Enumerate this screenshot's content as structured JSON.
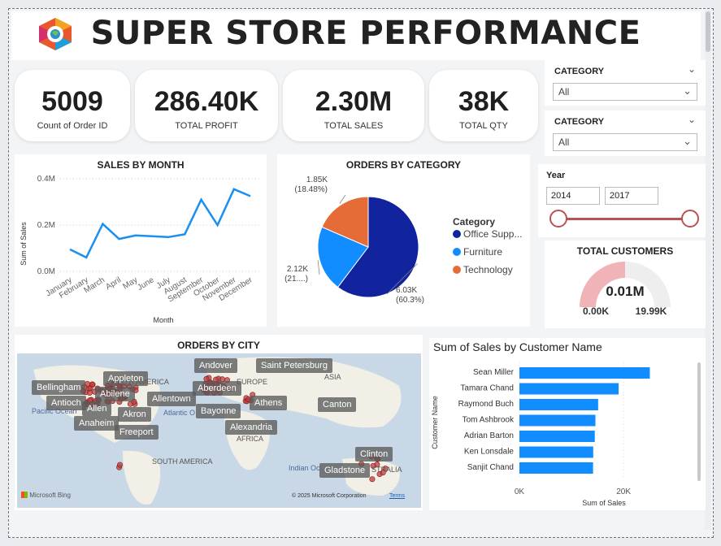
{
  "header": {
    "title": "SUPER STORE PERFORMANCE"
  },
  "kpis": [
    {
      "value": "5009",
      "label": "Count of Order ID"
    },
    {
      "value": "286.40K",
      "label": "TOTAL PROFIT"
    },
    {
      "value": "2.30M",
      "label": "TOTAL SALES"
    },
    {
      "value": "38K",
      "label": "TOTAL QTY"
    }
  ],
  "slicers": [
    {
      "header": "CATEGORY",
      "value": "All"
    },
    {
      "header": "CATEGORY",
      "value": "All"
    }
  ],
  "year_slicer": {
    "header": "Year",
    "from": "2014",
    "to": "2017",
    "range_fraction": [
      0,
      1
    ]
  },
  "total_customers": {
    "title": "TOTAL CUSTOMERS",
    "value": "0.01M",
    "min": "0.00K",
    "max": "19.99K",
    "fill_fraction": 0.5,
    "color": "#f0b4b8"
  },
  "map": {
    "title": "ORDERS BY CITY",
    "cities": [
      "Andover",
      "Saint Petersburg",
      "Appleton",
      "Bellingham",
      "Abilene",
      "Aberdeen",
      "Allentown",
      "Antioch",
      "Allen",
      "Akron",
      "Athens",
      "Canton",
      "Bayonne",
      "Anaheim",
      "Freeport",
      "Alexandria",
      "Clinton",
      "Gladstone"
    ],
    "regions": [
      "EUROPE",
      "ASIA",
      "AFRICA",
      "SOUTH AMERICA",
      "Pacific Ocean",
      "Atlantic O",
      "Indian Oc",
      "STRALIA"
    ],
    "attribution": "© 2025 Microsoft Corporation",
    "terms": "Terms",
    "brand": "Microsoft Bing",
    "point_color": "#c43b3b"
  },
  "chart_data": [
    {
      "type": "line",
      "title": "SALES BY MONTH",
      "xlabel": "Month",
      "ylabel": "Sum of Sales",
      "categories": [
        "January",
        "February",
        "March",
        "April",
        "May",
        "June",
        "July",
        "August",
        "September",
        "October",
        "November",
        "December"
      ],
      "values": [
        0.095,
        0.06,
        0.205,
        0.14,
        0.155,
        0.152,
        0.148,
        0.16,
        0.31,
        0.2,
        0.355,
        0.325
      ],
      "yticks": [
        "0.0M",
        "0.2M",
        "0.4M"
      ],
      "ylim": [
        0,
        0.4
      ],
      "grid": true,
      "color": "#1a8ff0"
    },
    {
      "type": "pie",
      "title": "ORDERS BY CATEGORY",
      "legend_title": "Category",
      "legend_position": "right",
      "slices": [
        {
          "name": "Office Supp...",
          "value": 6.03,
          "label": "6.03K",
          "pct": "(60.3%)",
          "color": "#12239e"
        },
        {
          "name": "Furniture",
          "value": 2.12,
          "label": "2.12K",
          "pct": "(21....)",
          "color": "#118dff"
        },
        {
          "name": "Technology",
          "value": 1.85,
          "label": "1.85K",
          "pct": "(18.48%)",
          "color": "#e66c37"
        }
      ]
    },
    {
      "type": "bar",
      "orientation": "horizontal",
      "title": "Sum of Sales by Customer Name",
      "xlabel": "Sum of Sales",
      "ylabel": "Customer Name",
      "categories": [
        "Sean Miller",
        "Tamara Chand",
        "Raymond Buch",
        "Tom Ashbrook",
        "Adrian Barton",
        "Ken Lonsdale",
        "Sanjit Chand"
      ],
      "values": [
        25043,
        19052,
        15117,
        14596,
        14474,
        14175,
        14142
      ],
      "xticks": [
        "0K",
        "20K"
      ],
      "xlim": [
        0,
        32000
      ],
      "color": "#118dff"
    }
  ]
}
